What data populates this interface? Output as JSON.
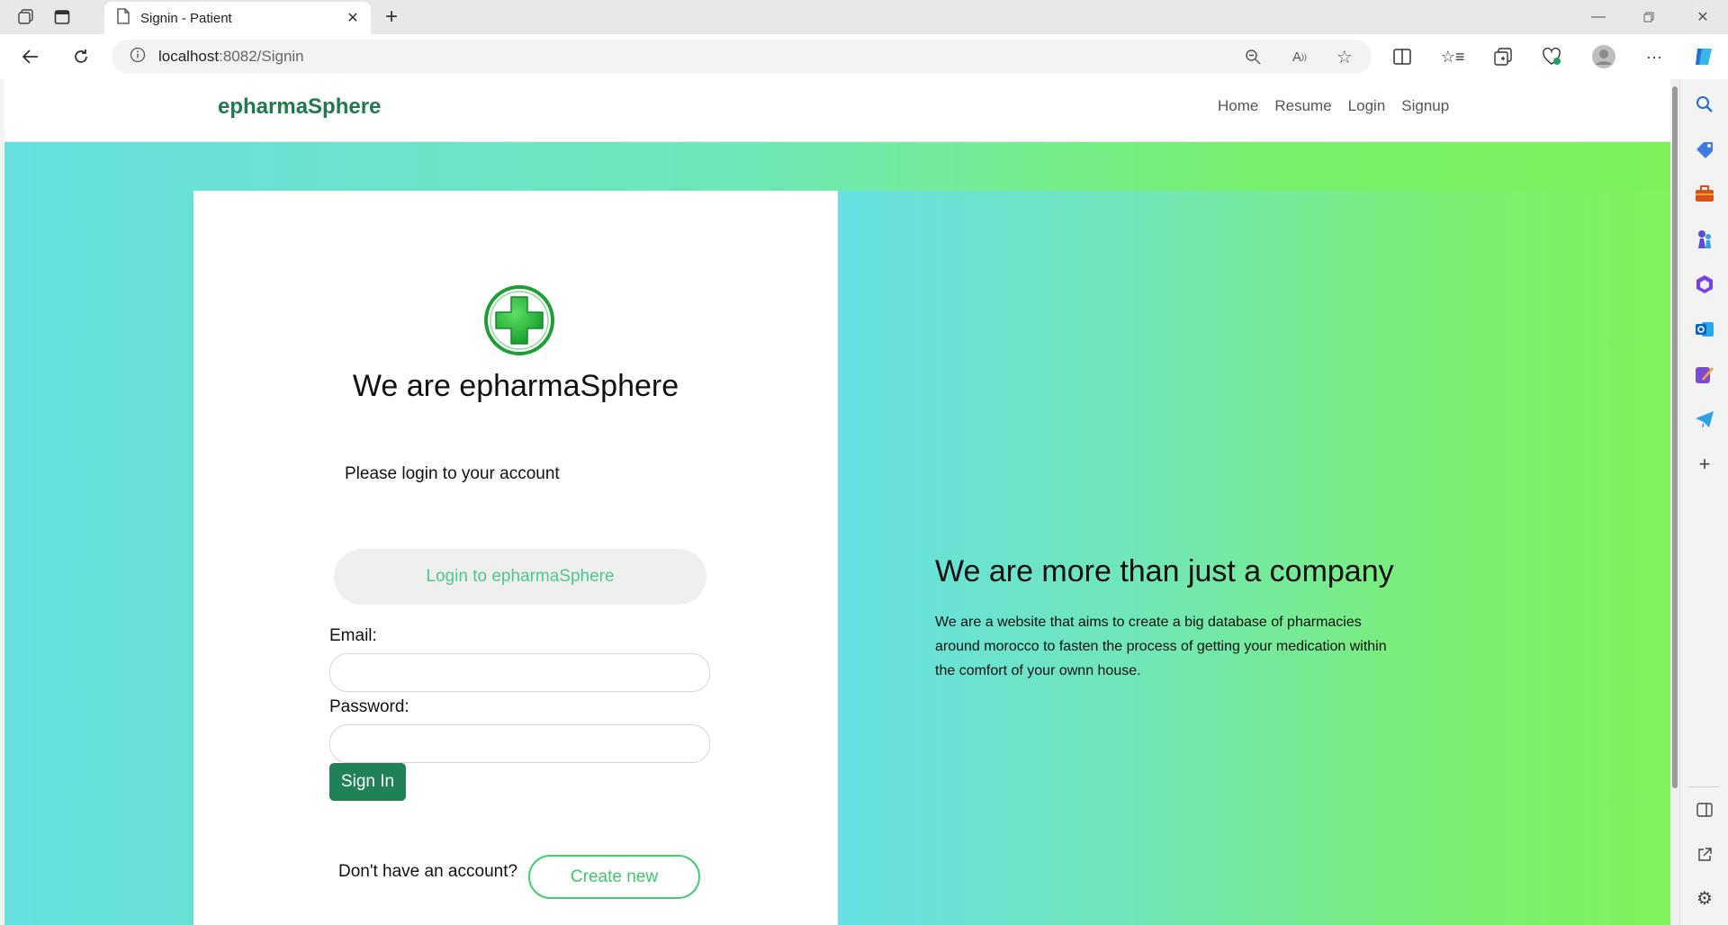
{
  "browser": {
    "tab_title": "Signin - Patient",
    "url_host": "localhost",
    "url_rest": ":8082/Signin"
  },
  "site": {
    "brand": "epharmaSphere",
    "nav": [
      "Home",
      "Resume",
      "Login",
      "Signup"
    ]
  },
  "login_card": {
    "headline": "We are epharmaSphere",
    "subline": "Please login to your account",
    "pill_label": "Login to epharmaSphere",
    "email_label": "Email:",
    "email_value": "",
    "password_label": "Password:",
    "password_value": "",
    "signin_label": "Sign In",
    "no_account_text": "Don't have an account?",
    "create_label": "Create new"
  },
  "promo": {
    "title": "We are more than just a company",
    "text": "We are a website that aims to create a big database of pharmacies around morocco to fasten the process of getting your medication within the comfort of your ownn house."
  },
  "colors": {
    "brand": "#1f7a4d",
    "button": "#1f8155",
    "gradient_start": "#66e0e1",
    "gradient_end": "#7ff25a",
    "logo_green": "#28b53a"
  }
}
